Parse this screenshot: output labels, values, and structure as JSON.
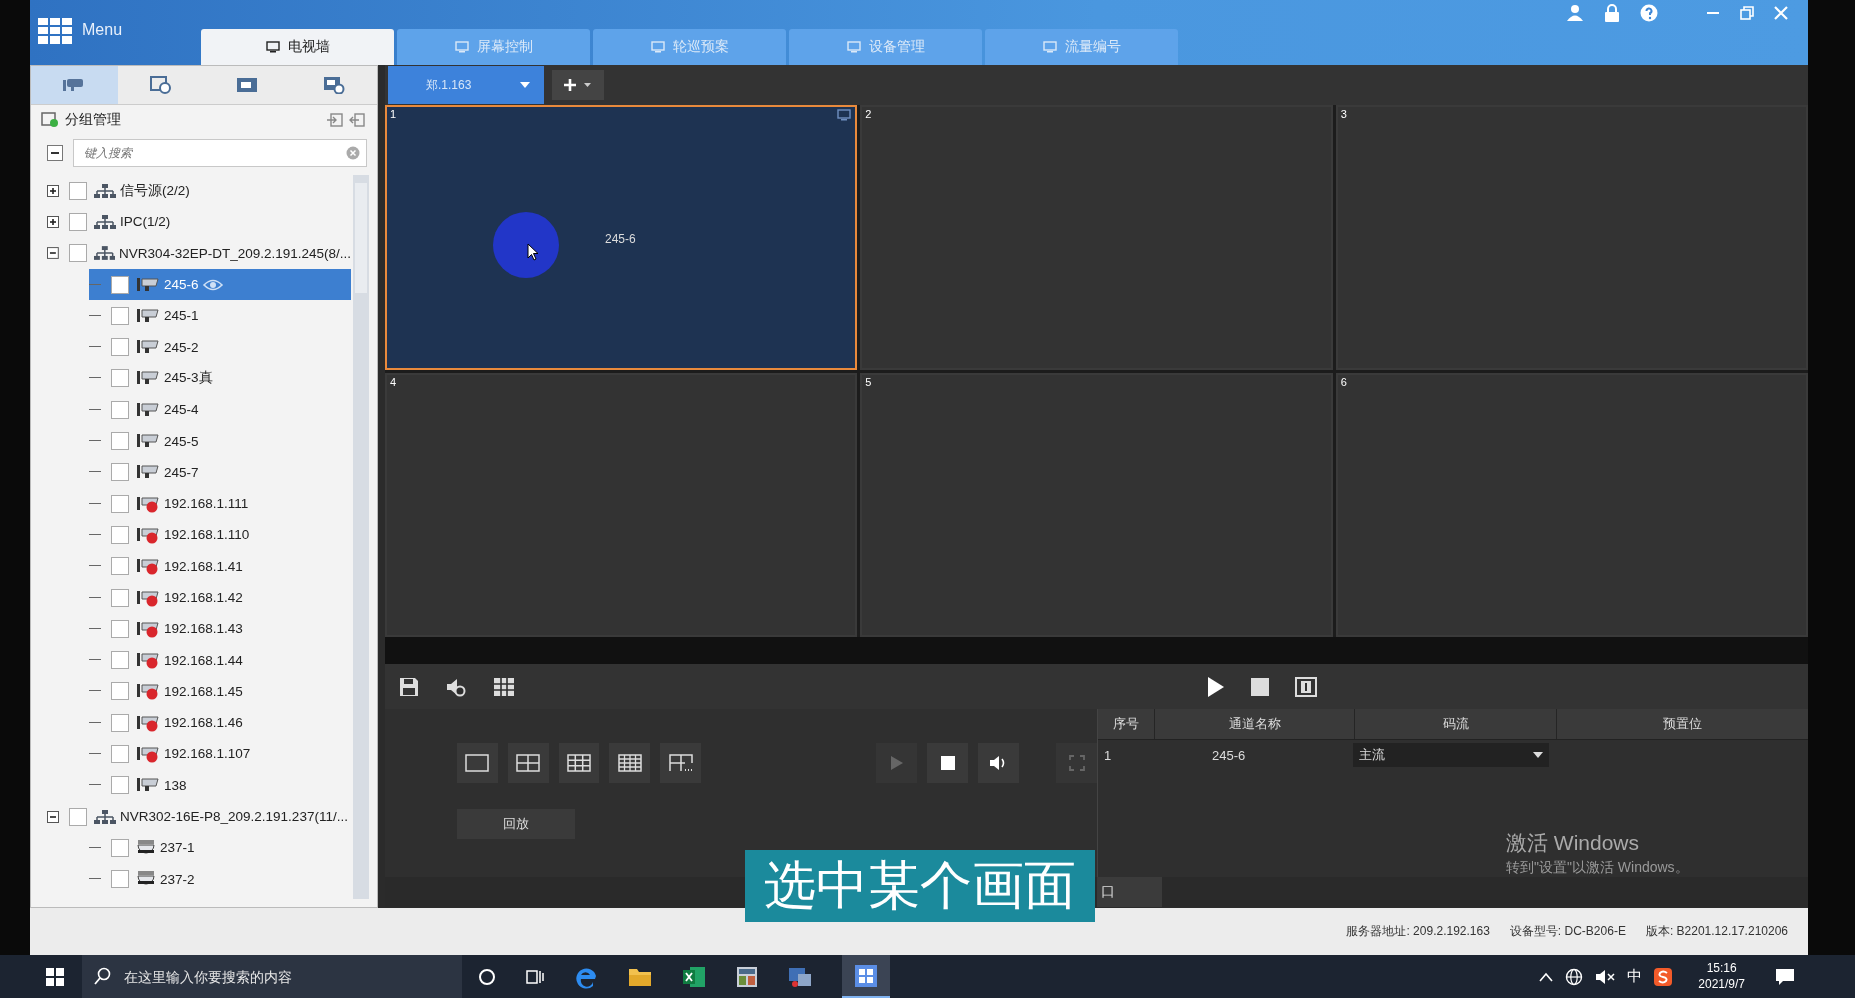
{
  "title_bar": {
    "menu_label": "Menu"
  },
  "main_tabs": [
    {
      "label": "电视墙",
      "selected": true
    },
    {
      "label": "屏幕控制",
      "selected": false
    },
    {
      "label": "轮巡预案",
      "selected": false
    },
    {
      "label": "设备管理",
      "selected": false
    },
    {
      "label": "流量编号",
      "selected": false
    }
  ],
  "panel_tabs": [
    {
      "kind": "camera",
      "selected": true
    },
    {
      "kind": "playback",
      "selected": false
    },
    {
      "kind": "screen",
      "selected": false
    },
    {
      "kind": "screen-gear",
      "selected": false
    }
  ],
  "group_panel": {
    "title": "分组管理",
    "search": {
      "placeholder": "键入搜索"
    },
    "tree": [
      {
        "label": "信号源(2/2)",
        "kind": "group",
        "expanded": false,
        "checked": false,
        "selected": false
      },
      {
        "label": "IPC(1/2)",
        "kind": "group",
        "expanded": false,
        "checked": false,
        "selected": false
      },
      {
        "label": "NVR304-32EP-DT_209.2.191.245(8/...",
        "kind": "group",
        "expanded": true,
        "checked": false,
        "selected": false,
        "children": [
          {
            "label": "245-6",
            "kind": "camera",
            "checked": false,
            "selected": true,
            "previewing": true
          },
          {
            "label": "245-1",
            "kind": "camera",
            "checked": false,
            "selected": false,
            "previewing": false
          },
          {
            "label": "245-2",
            "kind": "camera",
            "checked": false,
            "selected": false,
            "previewing": false
          },
          {
            "label": "245-3真",
            "kind": "camera",
            "checked": false,
            "selected": false,
            "previewing": false
          },
          {
            "label": "245-4",
            "kind": "camera",
            "checked": false,
            "selected": false,
            "previewing": false
          },
          {
            "label": "245-5",
            "kind": "camera",
            "checked": false,
            "selected": false,
            "previewing": false
          },
          {
            "label": "245-7",
            "kind": "camera",
            "checked": false,
            "selected": false,
            "previewing": false
          },
          {
            "label": "192.168.1.111",
            "kind": "camera-offline",
            "checked": false,
            "selected": false,
            "previewing": false
          },
          {
            "label": "192.168.1.110",
            "kind": "camera-offline",
            "checked": false,
            "selected": false,
            "previewing": false
          },
          {
            "label": "192.168.1.41",
            "kind": "camera-offline",
            "checked": false,
            "selected": false,
            "previewing": false
          },
          {
            "label": "192.168.1.42",
            "kind": "camera-offline",
            "checked": false,
            "selected": false,
            "previewing": false
          },
          {
            "label": "192.168.1.43",
            "kind": "camera-offline",
            "checked": false,
            "selected": false,
            "previewing": false
          },
          {
            "label": "192.168.1.44",
            "kind": "camera-offline",
            "checked": false,
            "selected": false,
            "previewing": false
          },
          {
            "label": "192.168.1.45",
            "kind": "camera-offline",
            "checked": false,
            "selected": false,
            "previewing": false
          },
          {
            "label": "192.168.1.46",
            "kind": "camera-offline",
            "checked": false,
            "selected": false,
            "previewing": false
          },
          {
            "label": "192.168.1.107",
            "kind": "camera-offline",
            "checked": false,
            "selected": false,
            "previewing": false
          },
          {
            "label": "138",
            "kind": "camera",
            "checked": false,
            "selected": false,
            "previewing": false
          }
        ]
      },
      {
        "label": "NVR302-16E-P8_209.2.191.237(11/...",
        "kind": "group",
        "expanded": true,
        "checked": false,
        "selected": false,
        "children": [
          {
            "label": "237-1",
            "kind": "dome",
            "checked": false,
            "selected": false,
            "previewing": false
          },
          {
            "label": "237-2",
            "kind": "dome",
            "checked": false,
            "selected": false,
            "previewing": false
          }
        ]
      }
    ]
  },
  "wall_selector": {
    "value": "郑.1.163"
  },
  "video_grid": [
    {
      "number": "1",
      "selected": true,
      "channel": "245-6"
    },
    {
      "number": "2",
      "selected": false
    },
    {
      "number": "3",
      "selected": false
    },
    {
      "number": "4",
      "selected": false
    },
    {
      "number": "5",
      "selected": false
    },
    {
      "number": "6",
      "selected": false
    }
  ],
  "playback_button": "回放",
  "channel_table": {
    "columns": [
      "序号",
      "通道名称",
      "码流",
      "预置位"
    ],
    "rows": [
      {
        "index": "1",
        "name": "245-6",
        "stream": "主流"
      }
    ]
  },
  "bottom_tab": "口",
  "caption": "选中某个画面",
  "activation_notice": {
    "title": "激活 Windows",
    "hint": "转到\"设置\"以激活 Windows。"
  },
  "status_bar": [
    {
      "label": "服务器地址:",
      "value": "209.2.192.163"
    },
    {
      "label": "设备型号:",
      "value": "DC-B206-E"
    },
    {
      "label": "版本:",
      "value": "B2201.12.17.210206"
    }
  ],
  "taskbar": {
    "search_placeholder": "在这里输入你要搜索的内容",
    "ime": "中",
    "time": "15:16",
    "date": "2021/9/7"
  }
}
